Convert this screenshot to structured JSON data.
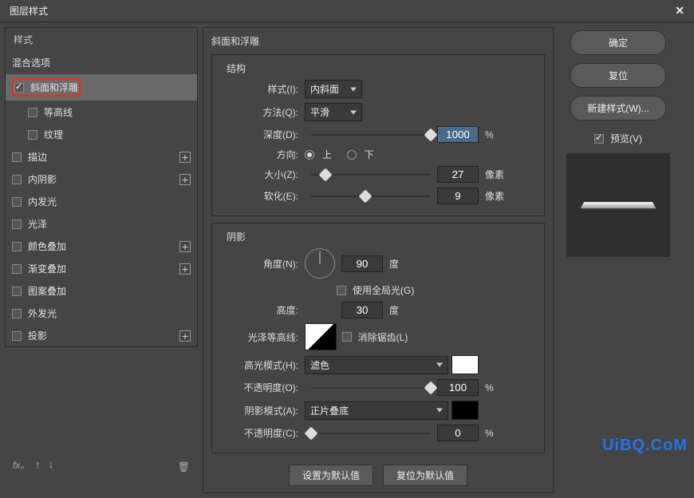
{
  "titlebar": {
    "title": "图层样式",
    "close": "✕"
  },
  "sidebar": {
    "styles_header": "样式",
    "blend_options": "混合选项",
    "items": [
      {
        "label": "斜面和浮雕",
        "checked": true,
        "selected": true,
        "plus": false,
        "sub": false,
        "highlight": true
      },
      {
        "label": "等高线",
        "checked": false,
        "selected": false,
        "plus": false,
        "sub": true
      },
      {
        "label": "纹理",
        "checked": false,
        "selected": false,
        "plus": false,
        "sub": true
      },
      {
        "label": "描边",
        "checked": false,
        "selected": false,
        "plus": true,
        "sub": false
      },
      {
        "label": "内阴影",
        "checked": false,
        "selected": false,
        "plus": true,
        "sub": false
      },
      {
        "label": "内发光",
        "checked": false,
        "selected": false,
        "plus": false,
        "sub": false
      },
      {
        "label": "光泽",
        "checked": false,
        "selected": false,
        "plus": false,
        "sub": false
      },
      {
        "label": "颜色叠加",
        "checked": false,
        "selected": false,
        "plus": true,
        "sub": false
      },
      {
        "label": "渐变叠加",
        "checked": false,
        "selected": false,
        "plus": true,
        "sub": false
      },
      {
        "label": "图案叠加",
        "checked": false,
        "selected": false,
        "plus": false,
        "sub": false
      },
      {
        "label": "外发光",
        "checked": false,
        "selected": false,
        "plus": false,
        "sub": false
      },
      {
        "label": "投影",
        "checked": false,
        "selected": false,
        "plus": true,
        "sub": false
      }
    ]
  },
  "bevel": {
    "section_title": "斜面和浮雕",
    "structure_title": "结构",
    "style_label": "样式(I):",
    "style_value": "内斜面",
    "technique_label": "方法(Q):",
    "technique_value": "平滑",
    "depth_label": "深度(D):",
    "depth_value": "1000",
    "depth_thumb_pct": 100,
    "direction_label": "方向:",
    "up_label": "上",
    "down_label": "下",
    "direction_up": true,
    "size_label": "大小(Z):",
    "size_value": "27",
    "size_thumb_pct": 12,
    "soften_label": "软化(E):",
    "soften_value": "9",
    "soften_thumb_pct": 45,
    "pixel_unit": "像素",
    "percent_unit": "%"
  },
  "shadow": {
    "section_title": "阴影",
    "angle_label": "角度(N):",
    "angle_value": "90",
    "degree_unit": "度",
    "global_light_label": "使用全局光(G)",
    "global_light_checked": false,
    "altitude_label": "高度:",
    "altitude_value": "30",
    "gloss_contour_label": "光泽等高线:",
    "antialias_label": "消除锯齿(L)",
    "antialias_checked": false,
    "highlight_mode_label": "高光模式(H):",
    "highlight_mode_value": "滤色",
    "highlight_opacity_label": "不透明度(O):",
    "highlight_opacity_value": "100",
    "highlight_thumb_pct": 100,
    "highlight_color": "#ffffff",
    "shadow_mode_label": "阴影模式(A):",
    "shadow_mode_value": "正片叠底",
    "shadow_opacity_label": "不透明度(C):",
    "shadow_opacity_value": "0",
    "shadow_thumb_pct": 0,
    "shadow_color": "#000000"
  },
  "buttons": {
    "ok": "确定",
    "reset": "复位",
    "new_style": "新建样式(W)...",
    "preview_label": "预览(V)",
    "preview_checked": true,
    "set_default": "设置为默认值",
    "reset_default": "复位为默认值"
  },
  "watermark": "UiBQ.CoM"
}
